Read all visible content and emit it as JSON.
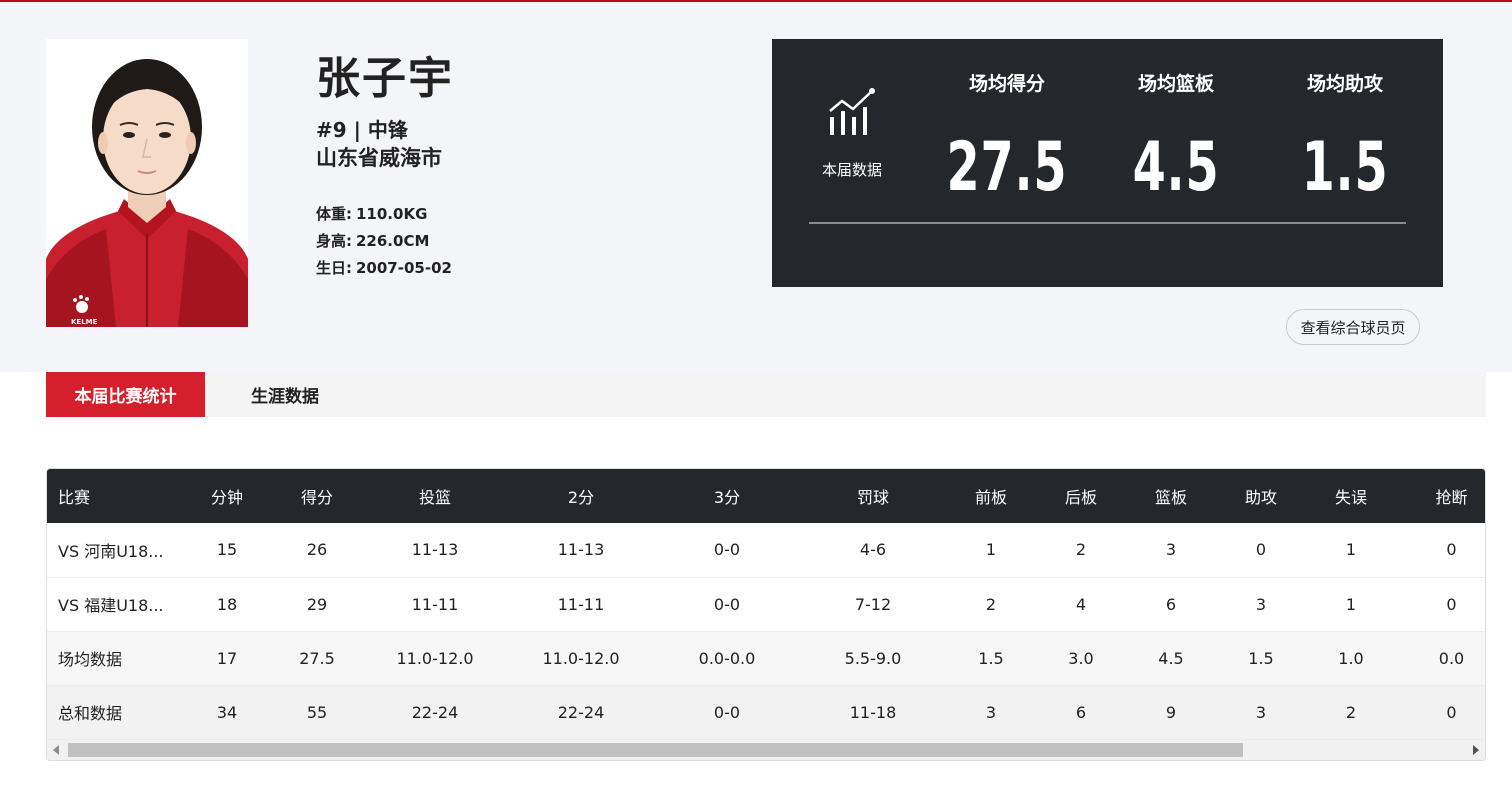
{
  "player": {
    "name": "张子宇",
    "number_position": "#9 | 中锋",
    "origin": "山东省威海市",
    "attributes": [
      {
        "label": "体重:",
        "value": "110.0KG"
      },
      {
        "label": "身高:",
        "value": "226.0CM"
      },
      {
        "label": "生日:",
        "value": "2007-05-02"
      }
    ],
    "jersey_brand": "KELME"
  },
  "season_panel": {
    "icon": "chart-growth-icon",
    "label": "本届数据",
    "stats": [
      {
        "label": "场均得分",
        "value": "27.5"
      },
      {
        "label": "场均篮板",
        "value": "4.5"
      },
      {
        "label": "场均助攻",
        "value": "1.5"
      }
    ]
  },
  "profile_button": "查看综合球员页",
  "tabs": [
    {
      "label": "本届比赛统计",
      "active": true
    },
    {
      "label": "生涯数据",
      "active": false
    }
  ],
  "table": {
    "headers": [
      "比赛",
      "分钟",
      "得分",
      "投篮",
      "2分",
      "3分",
      "罚球",
      "前板",
      "后板",
      "篮板",
      "助攻",
      "失误",
      "抢断"
    ],
    "rows": [
      [
        "VS 河南U18...",
        "15",
        "26",
        "11-13",
        "11-13",
        "0-0",
        "4-6",
        "1",
        "2",
        "3",
        "0",
        "1",
        "0"
      ],
      [
        "VS 福建U18...",
        "18",
        "29",
        "11-11",
        "11-11",
        "0-0",
        "7-12",
        "2",
        "4",
        "6",
        "3",
        "1",
        "0"
      ],
      [
        "场均数据",
        "17",
        "27.5",
        "11.0-12.0",
        "11.0-12.0",
        "0.0-0.0",
        "5.5-9.0",
        "1.5",
        "3.0",
        "4.5",
        "1.5",
        "1.0",
        "0.0"
      ],
      [
        "总和数据",
        "34",
        "55",
        "22-24",
        "22-24",
        "0-0",
        "11-18",
        "3",
        "6",
        "9",
        "3",
        "2",
        "0"
      ]
    ]
  },
  "colors": {
    "accent_red": "#d61f2c",
    "panel_dark": "#24282d",
    "hero_bg": "#f4f5f9"
  }
}
